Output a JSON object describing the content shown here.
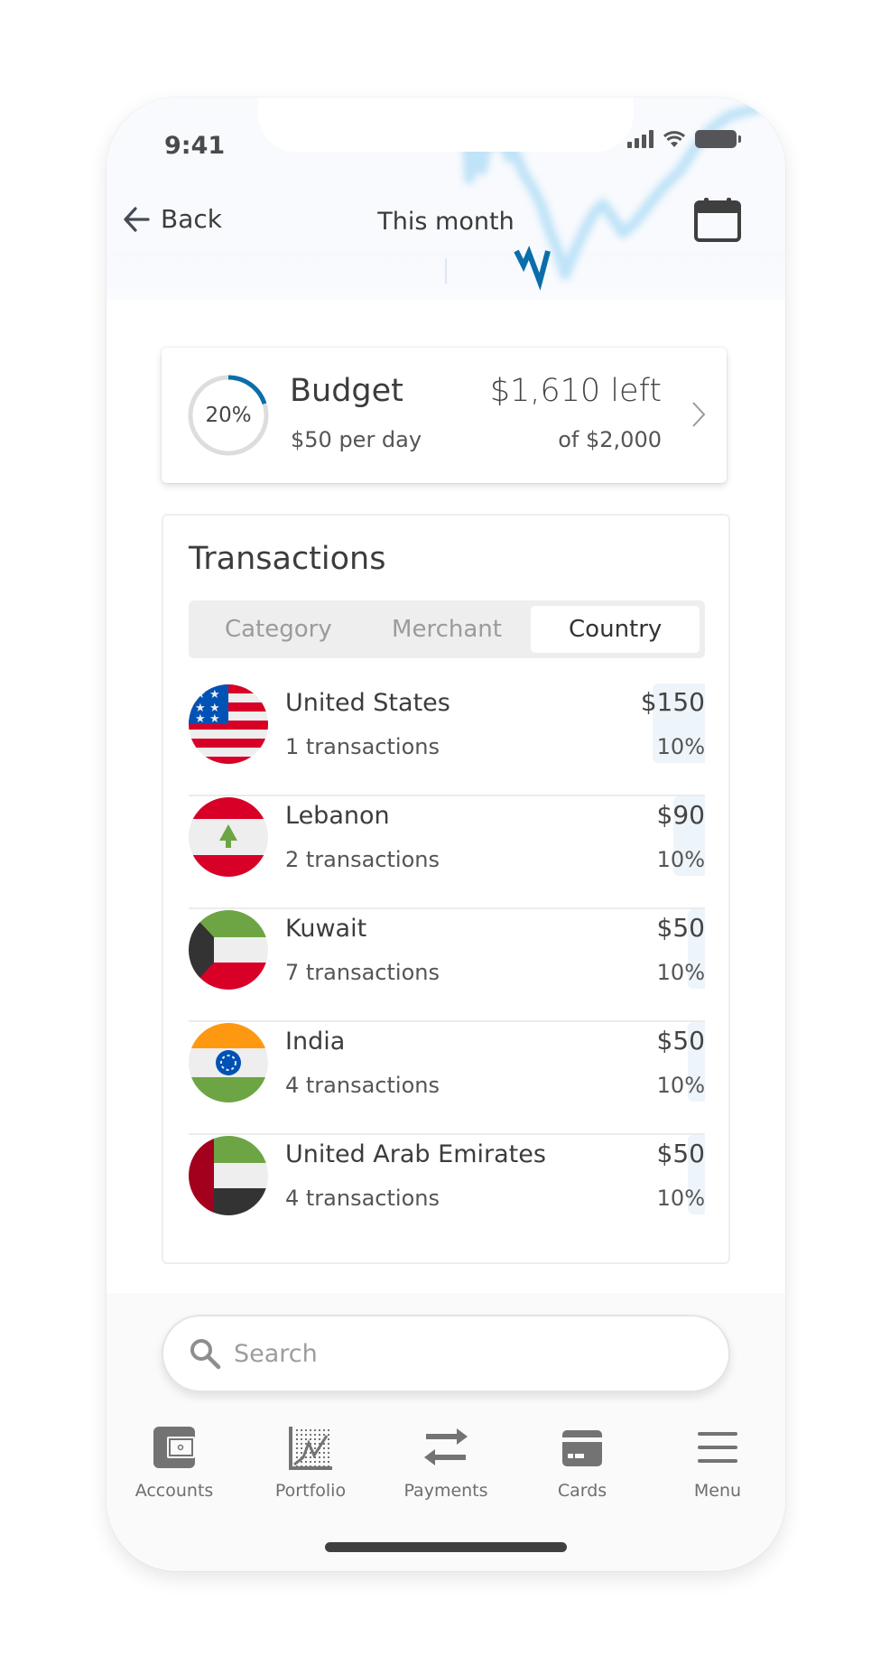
{
  "status_bar": {
    "time": "9:41"
  },
  "header": {
    "back_label": "Back",
    "title": "This month",
    "calendar_icon": "calendar-icon",
    "accent_color": "#0a6eaa"
  },
  "budget": {
    "percent_label": "20%",
    "percent_value": 0.2,
    "title": "Budget",
    "per_day": "$50 per day",
    "left": "$1,610 left",
    "of_total": "of $2,000",
    "ring_color": "#0a6eaa",
    "ring_track_color": "#dddddd"
  },
  "transactions": {
    "title": "Transactions",
    "tabs": [
      {
        "label": "Category",
        "active": false
      },
      {
        "label": "Merchant",
        "active": false
      },
      {
        "label": "Country",
        "active": true
      }
    ],
    "rows": [
      {
        "country": "United States",
        "count": "1 transactions",
        "amount": "$150",
        "percent": "10%",
        "flag": "us",
        "share": 150
      },
      {
        "country": "Lebanon",
        "count": "2 transactions",
        "amount": "$90",
        "percent": "10%",
        "flag": "lb",
        "share": 90
      },
      {
        "country": "Kuwait",
        "count": "7 transactions",
        "amount": "$50",
        "percent": "10%",
        "flag": "kw",
        "share": 50
      },
      {
        "country": "India",
        "count": "4 transactions",
        "amount": "$50",
        "percent": "10%",
        "flag": "in",
        "share": 50
      },
      {
        "country": "United Arab Emirates",
        "count": "4 transactions",
        "amount": "$50",
        "percent": "10%",
        "flag": "ae",
        "share": 50
      }
    ]
  },
  "search": {
    "placeholder": "Search",
    "value": ""
  },
  "tabbar": {
    "items": [
      {
        "label": "Accounts",
        "icon": "wallet-icon"
      },
      {
        "label": "Portfolio",
        "icon": "chart-icon"
      },
      {
        "label": "Payments",
        "icon": "transfer-arrows-icon"
      },
      {
        "label": "Cards",
        "icon": "credit-card-icon"
      },
      {
        "label": "Menu",
        "icon": "hamburger-menu-icon"
      }
    ]
  }
}
